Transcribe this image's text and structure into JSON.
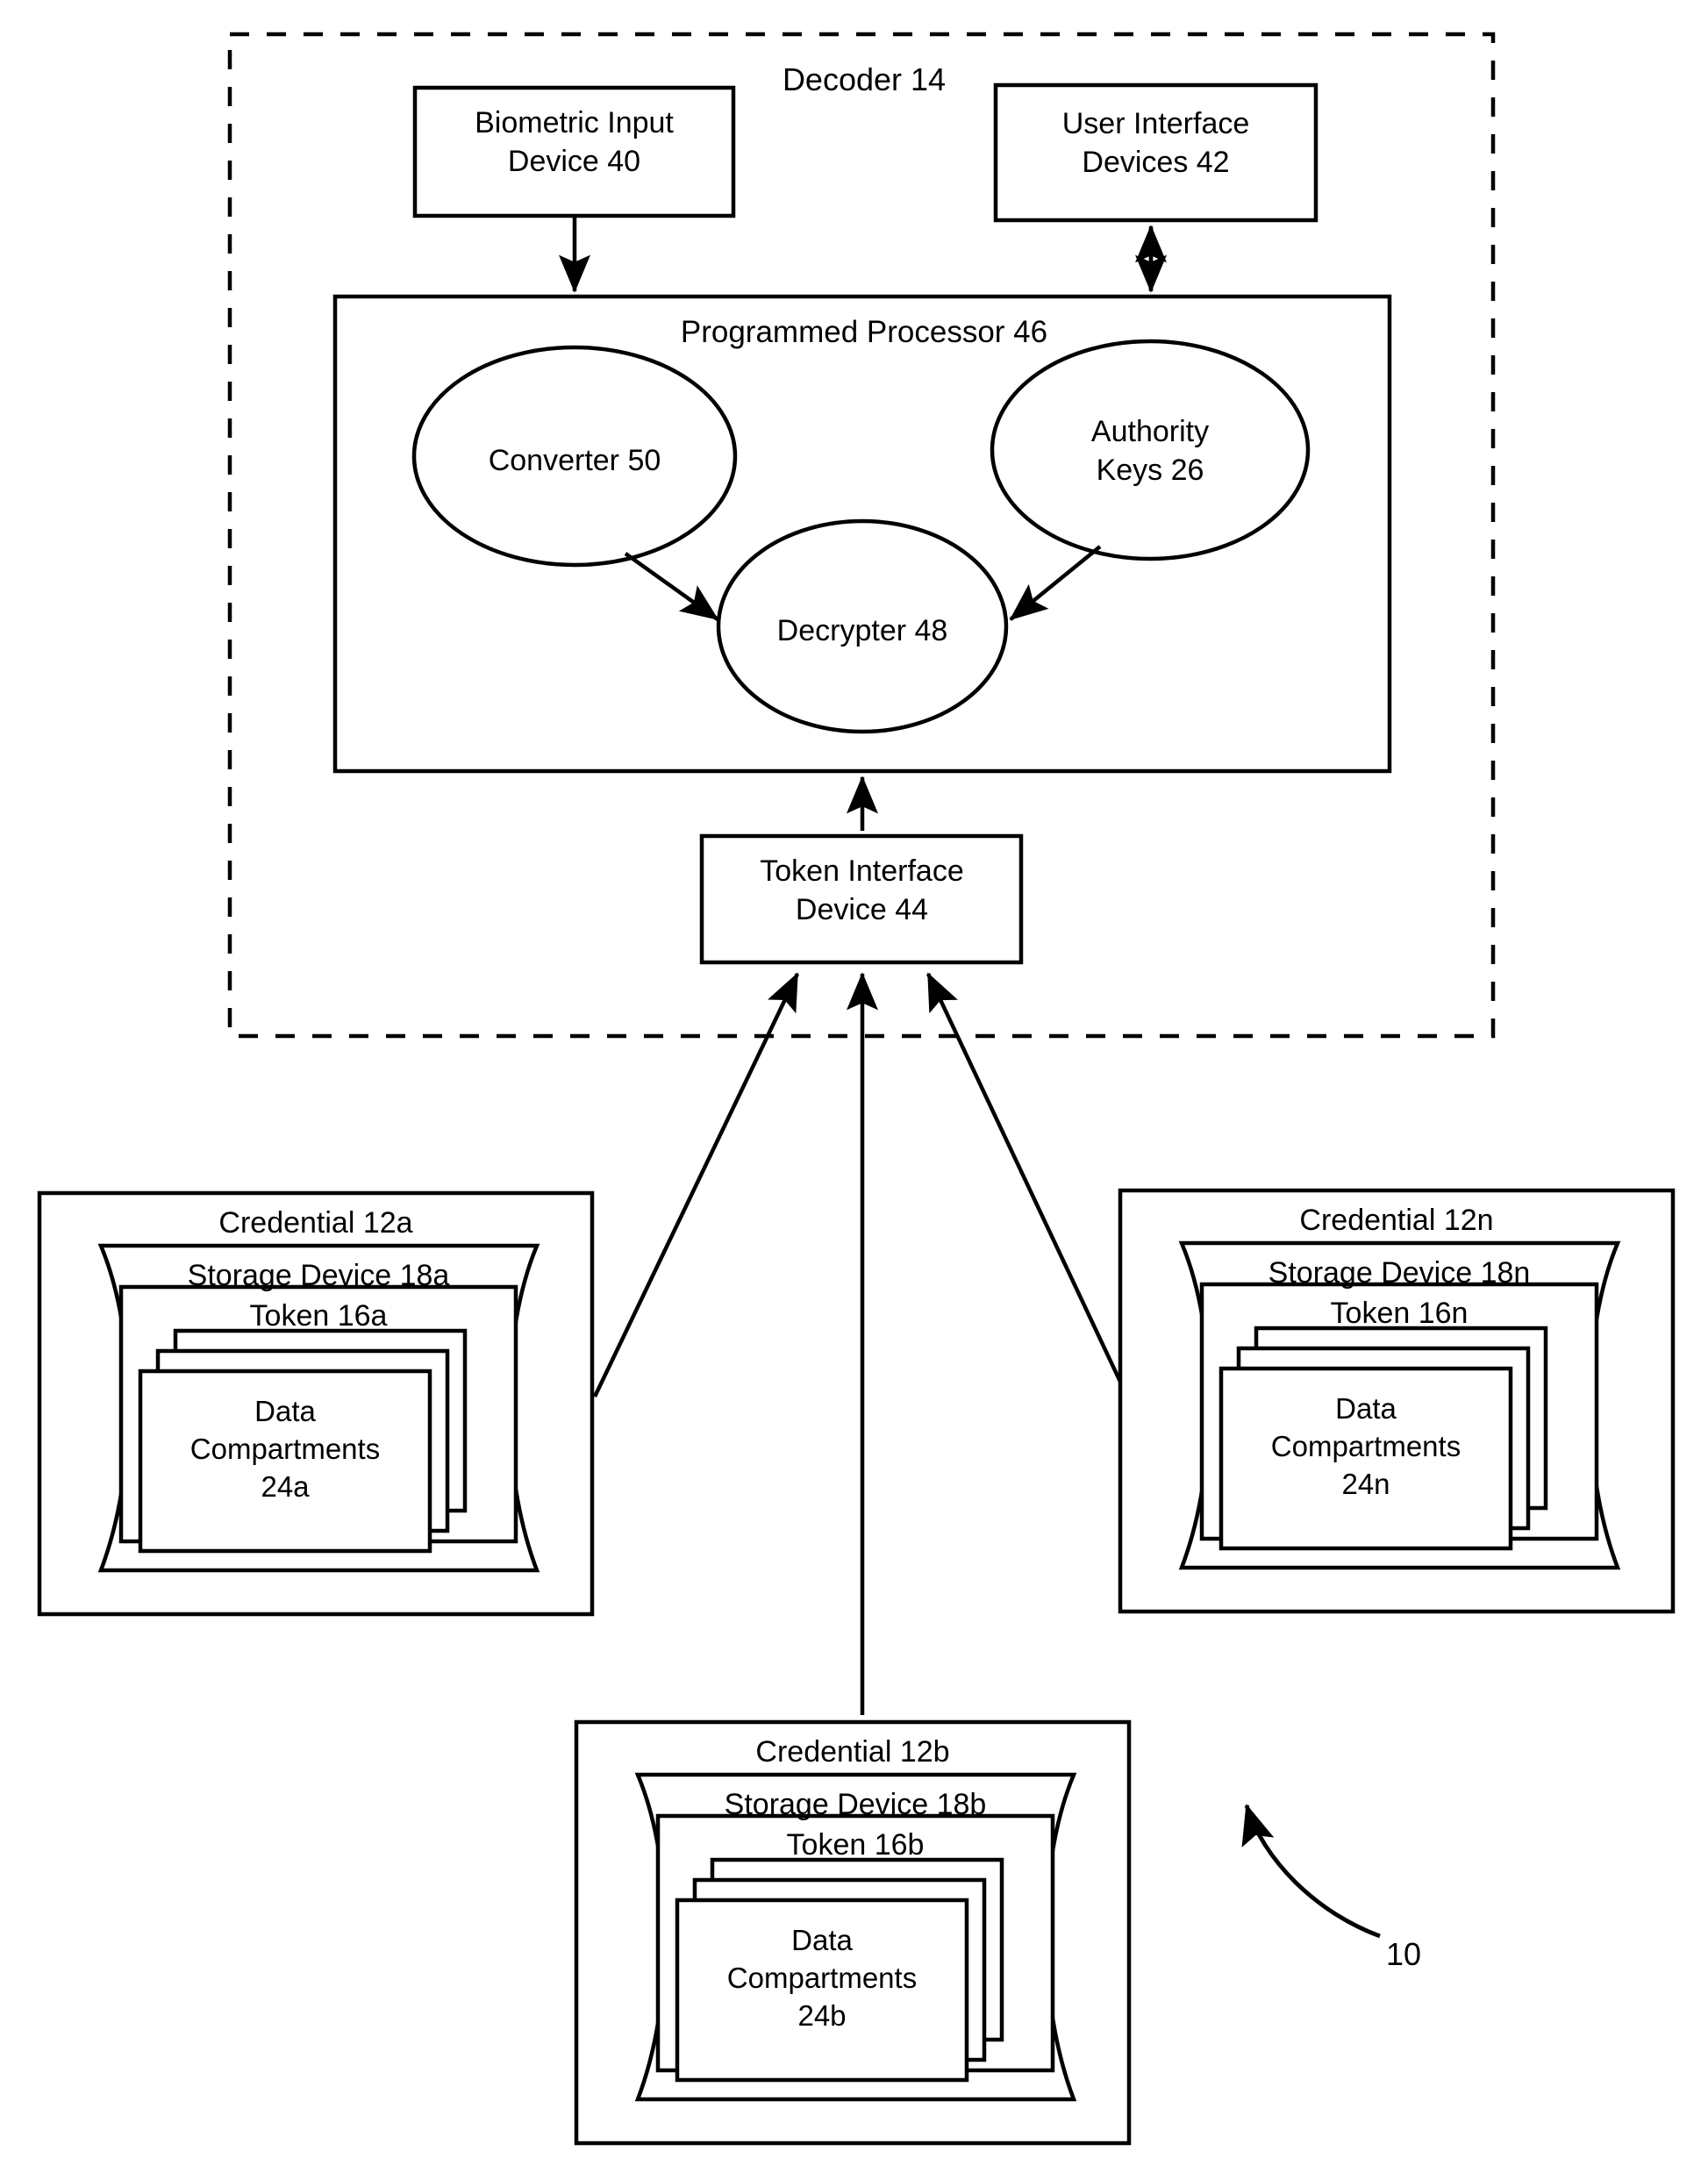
{
  "figure": {
    "reference_numeral": "10",
    "decoder": {
      "title": "Decoder 14",
      "biometric_input_device": "Biometric Input\nDevice 40",
      "user_interface_devices": "User Interface\nDevices 42",
      "programmed_processor": "Programmed Processor  46",
      "converter": "Converter 50",
      "authority_keys": "Authority\nKeys 26",
      "decrypter": "Decrypter 48",
      "token_interface_device": "Token Interface\nDevice 44"
    },
    "credentials": [
      {
        "id": "a",
        "credential_label": "Credential 12a",
        "storage_device_label": "Storage Device 18a",
        "token_label": "Token 16a",
        "data_compartments_label": "Data\nCompartments\n24a"
      },
      {
        "id": "n",
        "credential_label": "Credential 12n",
        "storage_device_label": "Storage Device 18n",
        "token_label": "Token 16n",
        "data_compartments_label": "Data\nCompartments\n24n"
      },
      {
        "id": "b",
        "credential_label": "Credential 12b",
        "storage_device_label": "Storage Device 18b",
        "token_label": "Token 16b",
        "data_compartments_label": "Data\nCompartments\n24b"
      }
    ]
  },
  "colors": {
    "ink": "#000000",
    "paper": "#ffffff"
  }
}
